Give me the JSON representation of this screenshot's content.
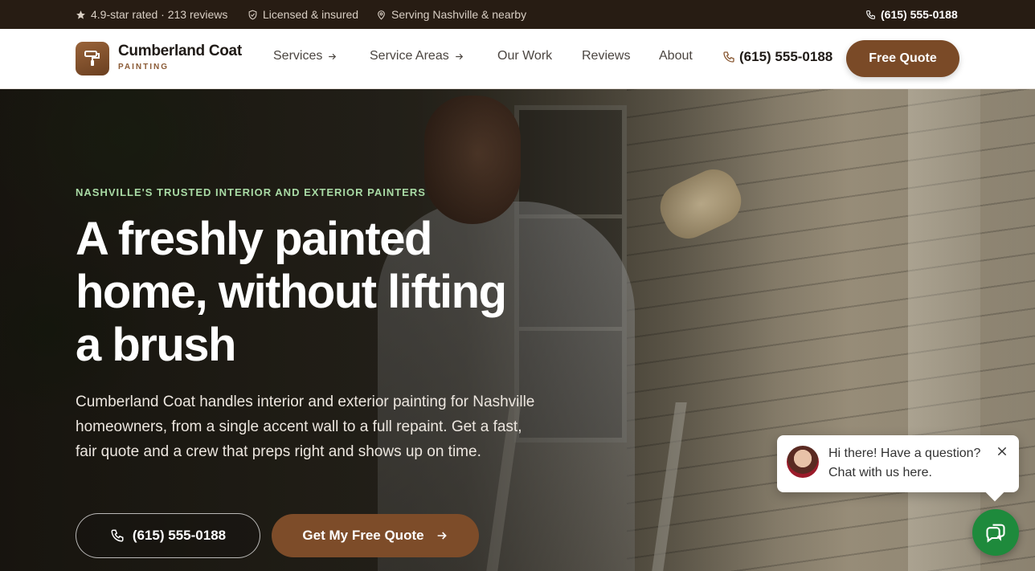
{
  "topbar": {
    "rating": "4.9-star rated · 213 reviews",
    "licensed": "Licensed & insured",
    "serving": "Serving Nashville & nearby",
    "phone": "(615) 555-0188"
  },
  "brand": {
    "name": "Cumberland Coat",
    "sub": "PAINTING",
    "logo_icon": "paint-roller-icon"
  },
  "nav": {
    "links": [
      "Services",
      "Service Areas",
      "Our Work",
      "Reviews",
      "About"
    ],
    "phone": "(615) 555-0188",
    "cta": "Free Quote"
  },
  "hero": {
    "eyebrow": "NASHVILLE'S TRUSTED INTERIOR AND EXTERIOR PAINTERS",
    "headline_line1": "A freshly painted",
    "headline_line2": "home, without lifting",
    "headline_line3": "a brush",
    "subtext": "Cumberland Coat handles interior and exterior painting for Nashville homeowners, from a single accent wall to a full repaint. Get a fast, fair quote and a crew that preps right and shows up on time.",
    "call_button": "(615) 555-0188",
    "quote_button": "Get My Free Quote"
  },
  "chat": {
    "line1": "Hi there! Have a question?",
    "line2": "Chat with us here."
  },
  "colors": {
    "brand_brown": "#7a4a27",
    "topbar_bg": "#271c13",
    "eyebrow_green": "#a9dba5",
    "chat_green": "#1e8a3c"
  }
}
